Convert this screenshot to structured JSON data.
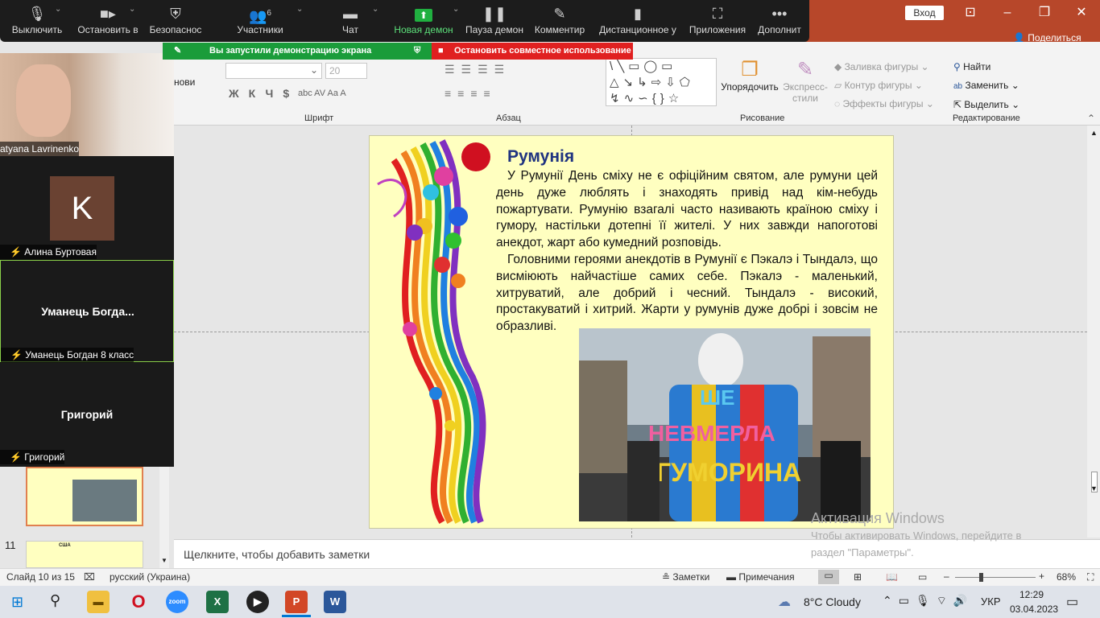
{
  "titlebar": {
    "signin": "Вход",
    "share": "Поделиться"
  },
  "zoom": {
    "buttons": [
      {
        "label": "Выключить",
        "icon": "microphone-icon",
        "glyph": "🎙"
      },
      {
        "label": "Остановить в",
        "icon": "video-camera-icon",
        "glyph": "▬"
      },
      {
        "label": "Безопаснос",
        "icon": "shield-icon",
        "glyph": "⛨"
      },
      {
        "label": "Участники",
        "icon": "participants-icon",
        "glyph": "👥",
        "badge": "6"
      },
      {
        "label": "Чат",
        "icon": "chat-icon",
        "glyph": "▭"
      },
      {
        "label": "Новая демон",
        "icon": "share-screen-icon",
        "glyph": "⬆"
      },
      {
        "label": "Пауза демон",
        "icon": "pause-icon",
        "glyph": "❚❚"
      },
      {
        "label": "Комментир",
        "icon": "pencil-icon",
        "glyph": "✎"
      },
      {
        "label": "Дистанционное у",
        "icon": "mouse-icon",
        "glyph": "▮"
      },
      {
        "label": "Приложения",
        "icon": "apps-icon",
        "glyph": "⬚"
      },
      {
        "label": "Дополнит",
        "icon": "more-icon",
        "glyph": "•••"
      }
    ],
    "share_notice": "Вы запустили демонстрацию экрана",
    "stop_share": "Остановить совместное использование",
    "participants": [
      {
        "name": "atyana Lavrinenko"
      },
      {
        "name": "Алина Буртовая",
        "initial": "K"
      },
      {
        "name": "Уманець Богдан 8 класс",
        "display": "Уманець Богда..."
      },
      {
        "name": "Григорий",
        "display": "Григорий"
      }
    ],
    "partial_label": "нови"
  },
  "ribbon": {
    "font_name": "",
    "font_size": "20",
    "groups": {
      "font": "Шрифт",
      "paragraph": "Абзац",
      "drawing": "Рисование",
      "editing": "Редактирование"
    },
    "arrange": "Упорядочить",
    "quick_styles": "Экспресс-стили",
    "shape_fill": "Заливка фигуры",
    "shape_outline": "Контур фигуры",
    "shape_effects": "Эффекты фигуры",
    "find": "Найти",
    "replace": "Заменить",
    "select": "Выделить"
  },
  "slide": {
    "title": "Румунія",
    "para1_words": [
      "У",
      "Румунії",
      "День",
      "сміху",
      "не",
      "є",
      "офіційним",
      "святом,",
      "але",
      "румуни",
      "цей",
      "день",
      "дуже",
      "люблять",
      "і",
      "знаходять",
      "привід",
      "над",
      "кім-небудь",
      "пожартувати.",
      "Румунію",
      "взагалі",
      "часто",
      "називають",
      "країною",
      "сміху",
      "і",
      "гумору,",
      "настільки",
      "дотепні",
      "її",
      "жителі.",
      "У",
      "них",
      "завжди",
      "напоготові",
      "анекдот,",
      "жарт",
      "або",
      "кумедний",
      "розповідь."
    ],
    "para1": "У Румунії День сміху не є офіційним святом, але румуни цей день дуже люблять і знаходять привід над кім-небудь пожартувати. Румунію взагалі часто називають країною сміху і гумору, настільки дотепні її жителі. У них завжди напоготові анекдот, жарт або кумедний розповідь.",
    "para2": "Головними героями анекдотів в Румунії є Пэкалэ і Тындалэ, що висміюють найчастіше самих себе. Пэкалэ - маленький, хитруватий, але добрий і чесний. Тындалэ - високий, простакуватий і хитрий. Жарти у румунів дуже добрі і зовсім не образливі.",
    "photo_text1": "ШЕ",
    "photo_text2": "НЕВМЕРЛА",
    "photo_text3": "ГУМОРИНА"
  },
  "thumbnails": [
    {
      "number": "11",
      "title": "США"
    }
  ],
  "notes_placeholder": "Щелкните, чтобы добавить заметки",
  "status": {
    "slide": "Слайд 10 из 15",
    "language": "русский (Украина)",
    "notes": "Заметки",
    "comments": "Примечания",
    "zoom": "68%"
  },
  "watermark": {
    "title": "Активация Windows",
    "line1": "Чтобы активировать Windows, перейдите в",
    "line2": "раздел \"Параметры\"."
  },
  "taskbar": {
    "weather": "8°C  Cloudy",
    "lang": "УКР",
    "time": "12:29",
    "date": "03.04.2023"
  },
  "colors": {
    "accent": "#b7472a",
    "zoom_green": "#1a9c3a",
    "zoom_red": "#e02020"
  }
}
